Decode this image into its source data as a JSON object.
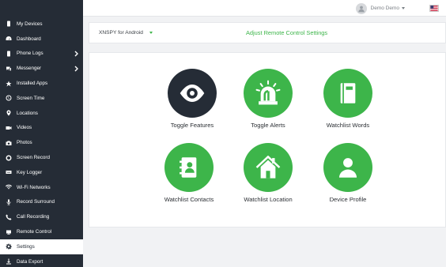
{
  "sidebar": {
    "items": [
      {
        "label": "My Devices",
        "icon": "phone-icon",
        "submenu": false,
        "active": false
      },
      {
        "label": "Dashboard",
        "icon": "dashboard-icon",
        "submenu": false,
        "active": false
      },
      {
        "label": "Phone Logs",
        "icon": "phone-logs-icon",
        "submenu": true,
        "active": false
      },
      {
        "label": "Messenger",
        "icon": "messenger-icon",
        "submenu": true,
        "active": false
      },
      {
        "label": "Installed Apps",
        "icon": "apps-icon",
        "submenu": false,
        "active": false
      },
      {
        "label": "Screen Time",
        "icon": "clock-icon",
        "submenu": false,
        "active": false
      },
      {
        "label": "Locations",
        "icon": "location-pin-icon",
        "submenu": false,
        "active": false
      },
      {
        "label": "Videos",
        "icon": "video-icon",
        "submenu": false,
        "active": false
      },
      {
        "label": "Photos",
        "icon": "camera-icon",
        "submenu": false,
        "active": false
      },
      {
        "label": "Screen Record",
        "icon": "record-icon",
        "submenu": false,
        "active": false
      },
      {
        "label": "Key Logger",
        "icon": "keyboard-icon",
        "submenu": false,
        "active": false
      },
      {
        "label": "Wi-Fi Networks",
        "icon": "wifi-icon",
        "submenu": false,
        "active": false
      },
      {
        "label": "Record Surround",
        "icon": "microphone-icon",
        "submenu": false,
        "active": false
      },
      {
        "label": "Call Recording",
        "icon": "call-icon",
        "submenu": false,
        "active": false
      },
      {
        "label": "Remote Control",
        "icon": "remote-icon",
        "submenu": false,
        "active": false
      },
      {
        "label": "Settings",
        "icon": "gear-icon",
        "submenu": false,
        "active": true
      },
      {
        "label": "Data Export",
        "icon": "download-icon",
        "submenu": false,
        "active": false
      }
    ]
  },
  "topbar": {
    "user_name": "Demo Demo",
    "flag": "us-flag-icon"
  },
  "controlbar": {
    "device": "XNSPY for Android",
    "title": "Adjust Remote Control Settings"
  },
  "features": [
    {
      "label": "Toggle Features",
      "icon": "eye-icon"
    },
    {
      "label": "Toggle Alerts",
      "icon": "siren-icon"
    },
    {
      "label": "Watchlist Words",
      "icon": "book-icon"
    },
    {
      "label": "Watchlist Contacts",
      "icon": "contacts-book-icon"
    },
    {
      "label": "Watchlist Location",
      "icon": "house-icon"
    },
    {
      "label": "Device Profile",
      "icon": "user-icon"
    }
  ],
  "colors": {
    "accent": "#3db54a",
    "sidebar": "#252c36"
  }
}
